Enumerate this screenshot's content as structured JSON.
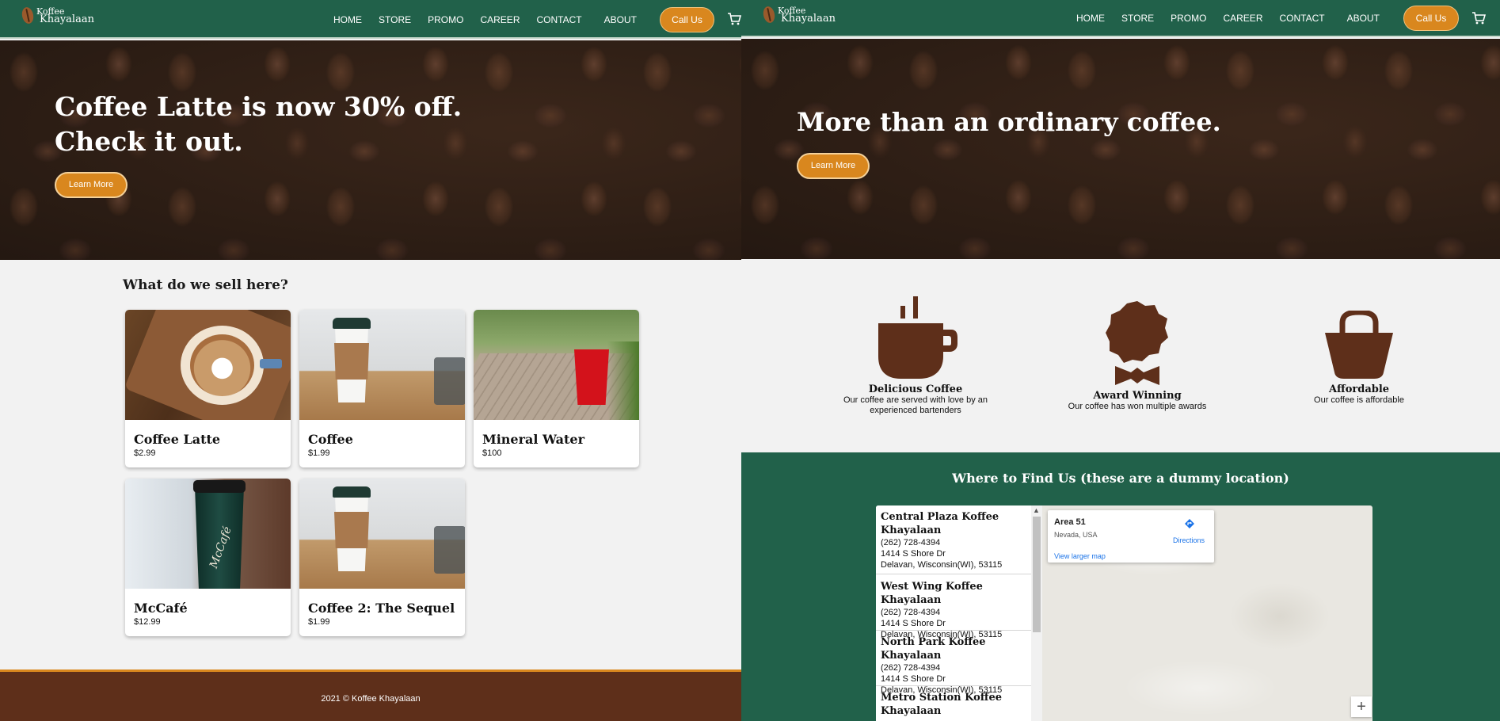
{
  "left": {
    "brand": {
      "line1": "Koffee",
      "line2": "Khayalaan"
    },
    "nav": [
      "HOME",
      "STORE",
      "PROMO",
      "CAREER",
      "CONTACT",
      "ABOUT"
    ],
    "call_label": "Call Us",
    "cart_icon": "cart-icon",
    "hero": {
      "title_line1": "Coffee Latte is now 30% off.",
      "title_line2": "Check it out.",
      "button": "Learn More"
    },
    "section_title": "What do we sell here?",
    "products": [
      {
        "name": "Coffee Latte",
        "price": "$2.99"
      },
      {
        "name": "Coffee",
        "price": "$1.99"
      },
      {
        "name": "Mineral Water",
        "price": "$100"
      },
      {
        "name": "McCafé",
        "price": "$12.99"
      },
      {
        "name": "Coffee 2: The Sequel",
        "price": "$1.99"
      }
    ],
    "mcd_cup_text": "McCafé",
    "footer": "2021 © Koffee Khayalaan"
  },
  "right": {
    "brand": {
      "line1": "Koffee",
      "line2": "Khayalaan"
    },
    "nav": [
      "HOME",
      "STORE",
      "PROMO",
      "CAREER",
      "CONTACT",
      "ABOUT"
    ],
    "call_label": "Call Us",
    "hero": {
      "title": "More than an ordinary coffee.",
      "button": "Learn More"
    },
    "features": [
      {
        "icon": "coffee-cup-icon",
        "title": "Delicious Coffee",
        "desc_line1": "Our coffee are served with love by an",
        "desc_line2": "experienced bartenders"
      },
      {
        "icon": "award-icon",
        "title": "Award Winning",
        "desc_line1": "Our coffee has won multiple awards",
        "desc_line2": ""
      },
      {
        "icon": "shopping-bag-icon",
        "title": "Affordable",
        "desc_line1": "Our coffee is affordable",
        "desc_line2": ""
      }
    ],
    "find_title": "Where to Find Us (these are a dummy location)",
    "locations": [
      {
        "name_line1": "Central Plaza Koffee",
        "name_line2": "Khayalaan",
        "phone": "(262) 728-4394",
        "street": "1414 S Shore Dr",
        "city": "Delavan, Wisconsin(WI), 53115"
      },
      {
        "name_line1": "West Wing Koffee Khayalaan",
        "name_line2": "",
        "phone": "(262) 728-4394",
        "street": "1414 S Shore Dr",
        "city": "Delavan, Wisconsin(WI), 53115"
      },
      {
        "name_line1": "North Park Koffee Khayalaan",
        "name_line2": "",
        "phone": "(262) 728-4394",
        "street": "1414 S Shore Dr",
        "city": "Delavan, Wisconsin(WI), 53115"
      },
      {
        "name_line1": "Metro Station Koffee",
        "name_line2": "Khayalaan",
        "phone": "",
        "street": "",
        "city": ""
      }
    ],
    "map": {
      "place": "Area 51",
      "region": "Nevada, USA",
      "directions": "Directions",
      "larger": "View larger map",
      "zoom_in": "+"
    }
  },
  "colors": {
    "nav_green": "#21614a",
    "accent_orange": "#d9871e",
    "footer_brown": "#5e2f1a",
    "icon_brown": "#5e2f1a"
  }
}
